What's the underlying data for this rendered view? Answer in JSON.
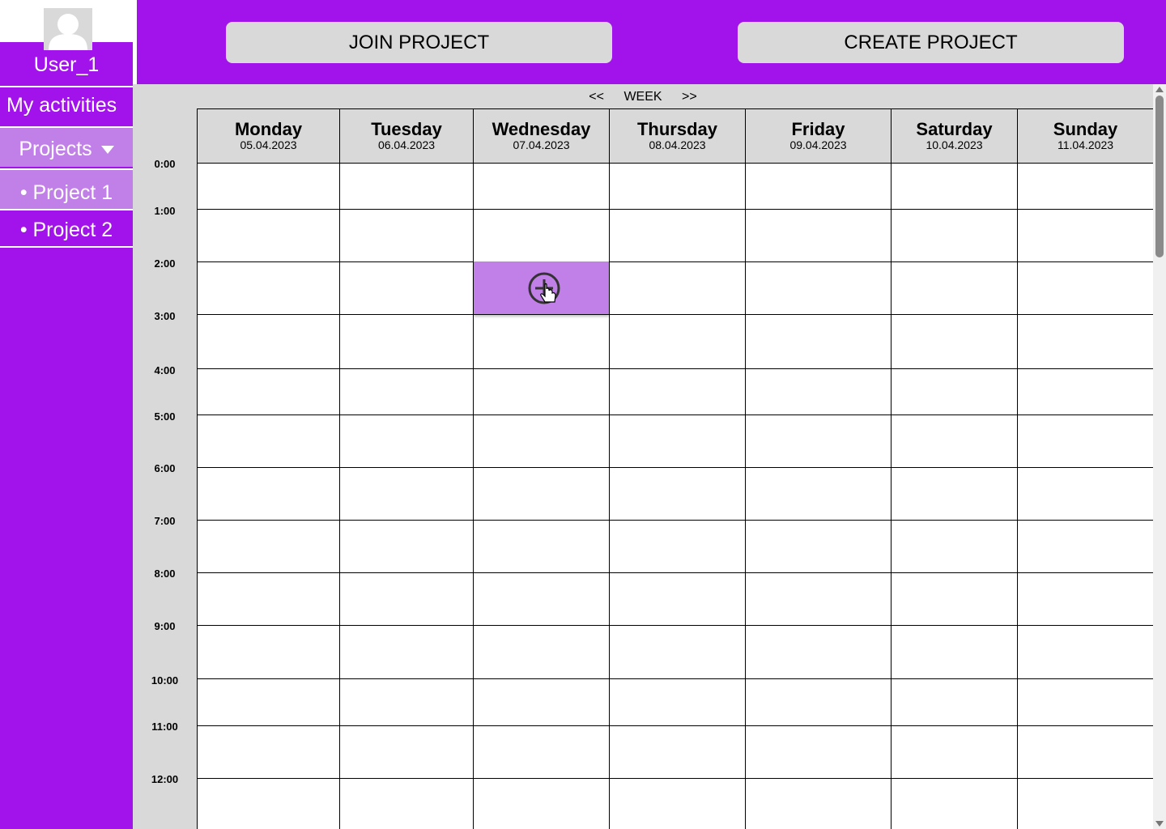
{
  "user": {
    "name": "User_1"
  },
  "sidebar": {
    "activities_label": "My activities",
    "projects_label": "Projects",
    "items": [
      {
        "label": "• Project 1"
      },
      {
        "label": "• Project 2"
      }
    ]
  },
  "header": {
    "join_label": "JOIN PROJECT",
    "create_label": "CREATE PROJECT"
  },
  "week_nav": {
    "prev": "<<",
    "label": "WEEK",
    "next": ">>"
  },
  "days": [
    {
      "name": "Monday",
      "date": "05.04.2023"
    },
    {
      "name": "Tuesday",
      "date": "06.04.2023"
    },
    {
      "name": "Wednesday",
      "date": "07.04.2023"
    },
    {
      "name": "Thursday",
      "date": "08.04.2023"
    },
    {
      "name": "Friday",
      "date": "09.04.2023"
    },
    {
      "name": "Saturday",
      "date": "10.04.2023"
    },
    {
      "name": "Sunday",
      "date": "11.04.2023"
    }
  ],
  "times": [
    "0:00",
    "1:00",
    "2:00",
    "3:00",
    "4:00",
    "5:00",
    "6:00",
    "7:00",
    "8:00",
    "9:00",
    "10:00",
    "11:00",
    "12:00"
  ],
  "selected_slot": {
    "day": "Wednesday",
    "time": "2:00",
    "icon": "add-circle-icon"
  },
  "colors": {
    "brand": "#a212ea",
    "highlight": "#c17fe8",
    "panel": "#d9d9d9"
  }
}
